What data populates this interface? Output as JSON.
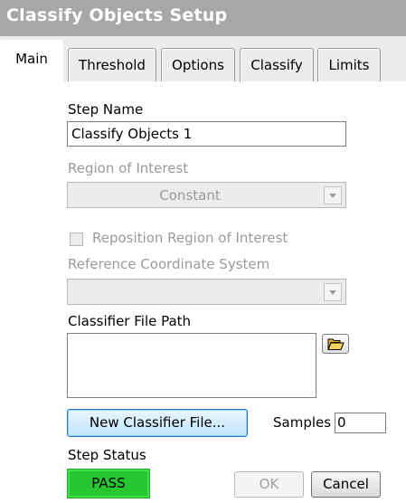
{
  "window": {
    "title": "Classify Objects Setup"
  },
  "tabs": [
    {
      "label": "Main",
      "active": true
    },
    {
      "label": "Threshold",
      "active": false
    },
    {
      "label": "Options",
      "active": false
    },
    {
      "label": "Classify",
      "active": false
    },
    {
      "label": "Limits",
      "active": false
    }
  ],
  "main": {
    "step_name_label": "Step Name",
    "step_name_value": "Classify Objects 1",
    "roi_label": "Region of Interest",
    "roi_value": "Constant",
    "reposition_label": "Reposition Region of Interest",
    "reposition_checked": false,
    "ref_coord_label": "Reference Coordinate System",
    "ref_coord_value": "",
    "classifier_path_label": "Classifier File Path",
    "classifier_path_value": "",
    "new_classifier_button": "New Classifier File...",
    "samples_label": "Samples",
    "samples_value": "0",
    "step_status_label": "Step Status",
    "step_status_value": "PASS"
  },
  "footer": {
    "ok_label": "OK",
    "cancel_label": "Cancel"
  },
  "colors": {
    "title_bar": "#a7a7a7",
    "window_bg": "#ececec",
    "status_pass": "#27c631",
    "focus_button": "#bee6fd"
  },
  "icons": {
    "browse": "folder-open-icon",
    "dropdown": "chevron-down-icon"
  }
}
